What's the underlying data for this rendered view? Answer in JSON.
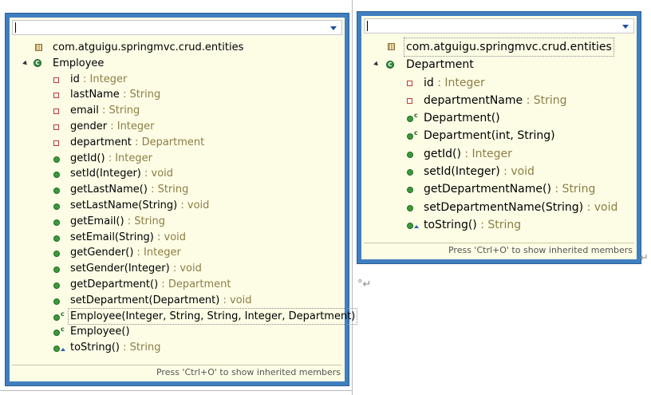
{
  "left_outline": {
    "filter_value": "",
    "package": "com.atguigu.springmvc.crud.entities",
    "class_name": "Employee",
    "members": [
      {
        "name": "id",
        "type": " : Integer",
        "kind": "field"
      },
      {
        "name": "lastName",
        "type": " : String",
        "kind": "field"
      },
      {
        "name": "email",
        "type": " : String",
        "kind": "field"
      },
      {
        "name": "gender",
        "type": " : Integer",
        "kind": "field"
      },
      {
        "name": "department",
        "type": " : Department",
        "kind": "field"
      },
      {
        "name": "getId()",
        "type": " : Integer",
        "kind": "method"
      },
      {
        "name": "setId(Integer)",
        "type": " : void",
        "kind": "method"
      },
      {
        "name": "getLastName()",
        "type": " : String",
        "kind": "method"
      },
      {
        "name": "setLastName(String)",
        "type": " : void",
        "kind": "method"
      },
      {
        "name": "getEmail()",
        "type": " : String",
        "kind": "method"
      },
      {
        "name": "setEmail(String)",
        "type": " : void",
        "kind": "method"
      },
      {
        "name": "getGender()",
        "type": " : Integer",
        "kind": "method"
      },
      {
        "name": "setGender(Integer)",
        "type": " : void",
        "kind": "method"
      },
      {
        "name": "getDepartment()",
        "type": " : Department",
        "kind": "method"
      },
      {
        "name": "setDepartment(Department)",
        "type": " : void",
        "kind": "method"
      },
      {
        "name": "Employee(Integer, String, String, Integer, Department)",
        "type": "",
        "kind": "constructor"
      },
      {
        "name": "Employee()",
        "type": "",
        "kind": "constructor"
      },
      {
        "name": "toString()",
        "type": " : String",
        "kind": "override"
      }
    ],
    "status": "Press 'Ctrl+O' to show inherited members"
  },
  "right_outline": {
    "filter_value": "",
    "package": "com.atguigu.springmvc.crud.entities",
    "class_name": "Department",
    "members": [
      {
        "name": "id",
        "type": " : Integer",
        "kind": "field"
      },
      {
        "name": "departmentName",
        "type": " : String",
        "kind": "field"
      },
      {
        "name": "Department()",
        "type": "",
        "kind": "constructor"
      },
      {
        "name": "Department(int, String)",
        "type": "",
        "kind": "constructor"
      },
      {
        "name": "getId()",
        "type": " : Integer",
        "kind": "method"
      },
      {
        "name": "setId(Integer)",
        "type": " : void",
        "kind": "method"
      },
      {
        "name": "getDepartmentName()",
        "type": " : String",
        "kind": "method"
      },
      {
        "name": "setDepartmentName(String)",
        "type": " : void",
        "kind": "method"
      },
      {
        "name": "toString()",
        "type": " : String",
        "kind": "override"
      }
    ],
    "status": "Press 'Ctrl+O' to show inherited members"
  },
  "glyphs": {
    "return_arrow": "↵",
    "return_arrow_with_ring": "°↵"
  },
  "colors": {
    "popup_border": "#3f7fbf",
    "popup_background": "#fdfde6",
    "return_type": "#8c7d46",
    "field_icon": "#c0392b",
    "method_icon": "#3b9a3b"
  }
}
